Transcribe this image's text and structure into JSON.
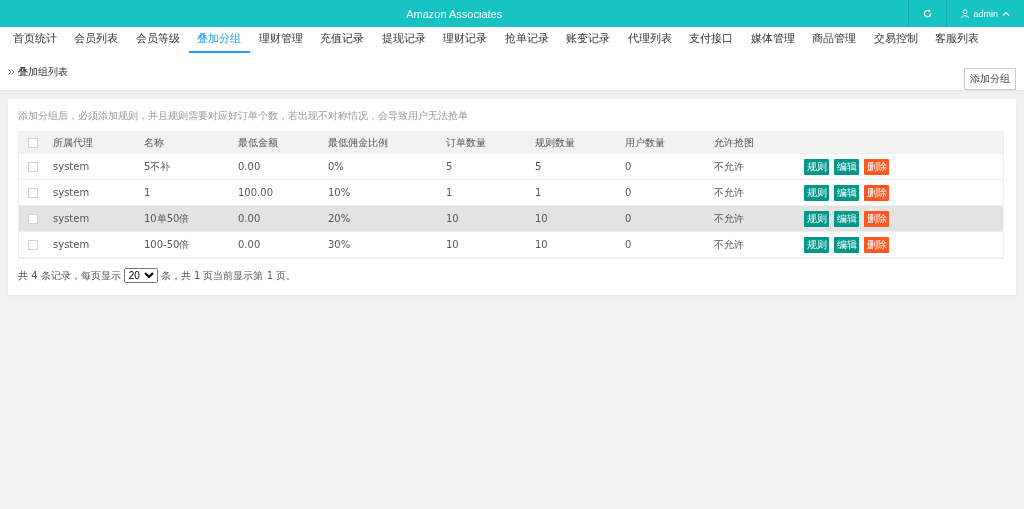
{
  "header": {
    "title": "Amazon Associates",
    "user": "admin"
  },
  "nav": [
    {
      "label": "首页统计",
      "selected": false
    },
    {
      "label": "会员列表",
      "selected": false
    },
    {
      "label": "会员等级",
      "selected": false
    },
    {
      "label": "叠加分组",
      "selected": true
    },
    {
      "label": "理财管理",
      "selected": false
    },
    {
      "label": "充值记录",
      "selected": false
    },
    {
      "label": "提现记录",
      "selected": false
    },
    {
      "label": "理财记录",
      "selected": false
    },
    {
      "label": "抢单记录",
      "selected": false
    },
    {
      "label": "账变记录",
      "selected": false
    },
    {
      "label": "代理列表",
      "selected": false
    },
    {
      "label": "支付接口",
      "selected": false
    },
    {
      "label": "媒体管理",
      "selected": false
    },
    {
      "label": "商品管理",
      "selected": false
    },
    {
      "label": "交易控制",
      "selected": false
    },
    {
      "label": "客服列表",
      "selected": false
    }
  ],
  "breadcrumb": "叠加组列表",
  "add_button": "添加分组",
  "notice": "添加分组后，必须添加规则，并且规则需要对应好订单个数，若出现不对称情况，会导致用户无法抢单",
  "table": {
    "all_checked": false,
    "columns": [
      "所属代理",
      "名称",
      "最低金额",
      "最低佣金比例",
      "订单数量",
      "规则数量",
      "用户数量",
      "允许抢图"
    ],
    "rows": [
      {
        "cells": [
          "system",
          "5不补",
          "0.00",
          "0%",
          "5",
          "5",
          "0",
          "不允许"
        ],
        "checked": false,
        "highlighted": false,
        "actions": [
          "规则",
          "编辑",
          "删除"
        ]
      },
      {
        "cells": [
          "system",
          "1",
          "100.00",
          "10%",
          "1",
          "1",
          "0",
          "不允许"
        ],
        "checked": false,
        "highlighted": false,
        "actions": [
          "规则",
          "编辑",
          "删除"
        ]
      },
      {
        "cells": [
          "system",
          "10单50倍",
          "0.00",
          "20%",
          "10",
          "10",
          "0",
          "不允许"
        ],
        "checked": false,
        "highlighted": true,
        "actions": [
          "规则",
          "编辑",
          "删除"
        ]
      },
      {
        "cells": [
          "system",
          "100-50倍",
          "0.00",
          "30%",
          "10",
          "10",
          "0",
          "不允许"
        ],
        "checked": false,
        "highlighted": false,
        "actions": [
          "规则",
          "编辑",
          "删除"
        ]
      }
    ]
  },
  "pagination": {
    "before": "共 4 条记录，每页显示",
    "page_size": "20",
    "after": "条，共 1 页当前显示第 1 页。"
  }
}
